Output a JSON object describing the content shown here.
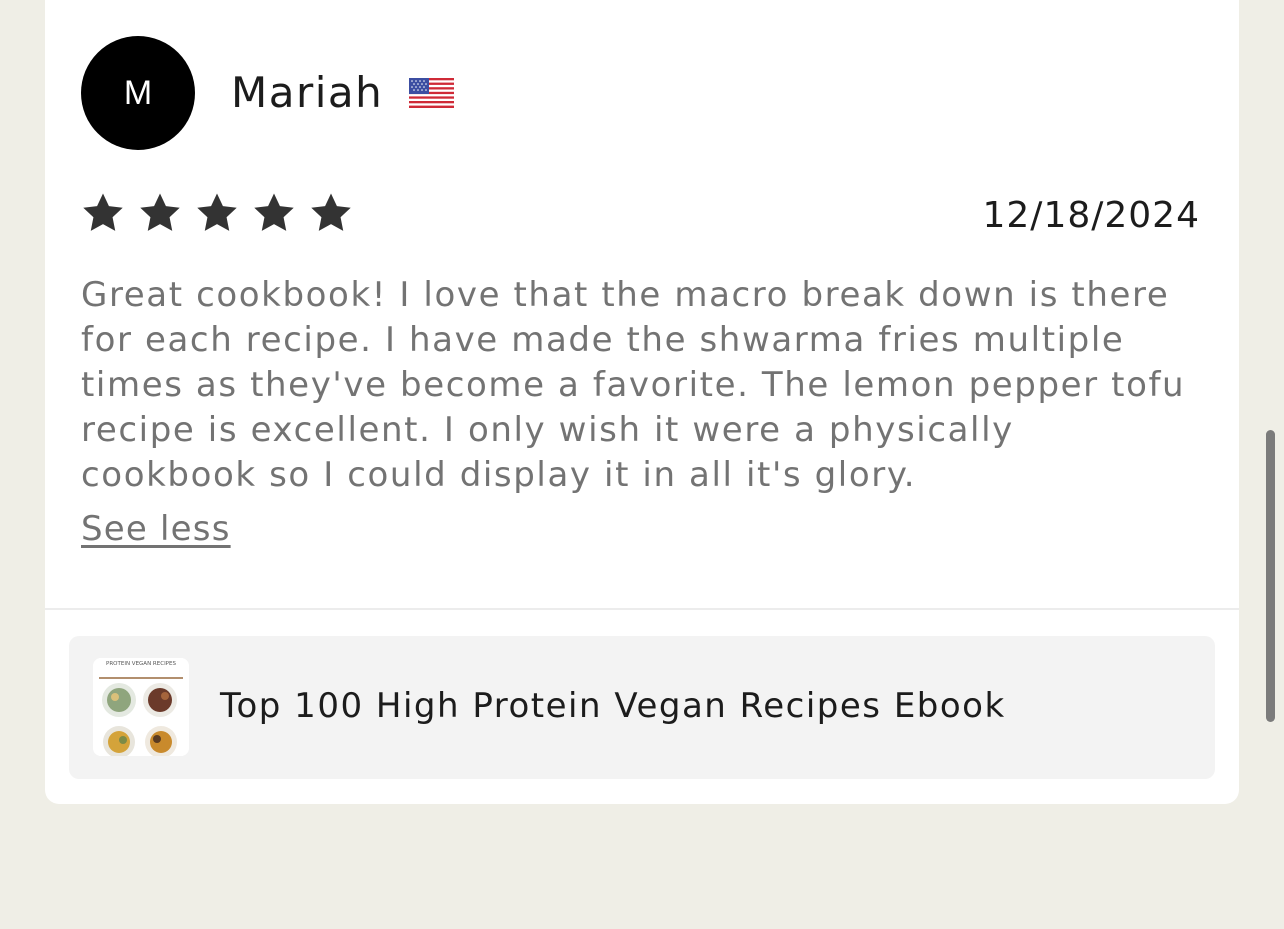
{
  "review": {
    "avatar_initial": "M",
    "reviewer_name": "Mariah",
    "country_flag_icon": "us-flag-icon",
    "rating": 5,
    "rating_max": 5,
    "date": "12/18/2024",
    "text_lines": [
      "Great cookbook! I love that the macro break down is there",
      "for each recipe. I have made the shwarma fries multiple",
      "times as they've become a favorite. The lemon pepper tofu",
      "recipe is excellent. I only wish it were a physically",
      "cookbook so I could display it in all it's glory."
    ],
    "see_less_label": "See less"
  },
  "product": {
    "title": "Top 100 High Protein Vegan Recipes Ebook",
    "thumbnail_text": "PROTEIN VEGAN RECIPES"
  },
  "colors": {
    "page_background": "#efeee6",
    "card_background": "#ffffff",
    "star_color": "#333333",
    "muted_text": "#737373",
    "product_background": "#f3f3f3"
  }
}
